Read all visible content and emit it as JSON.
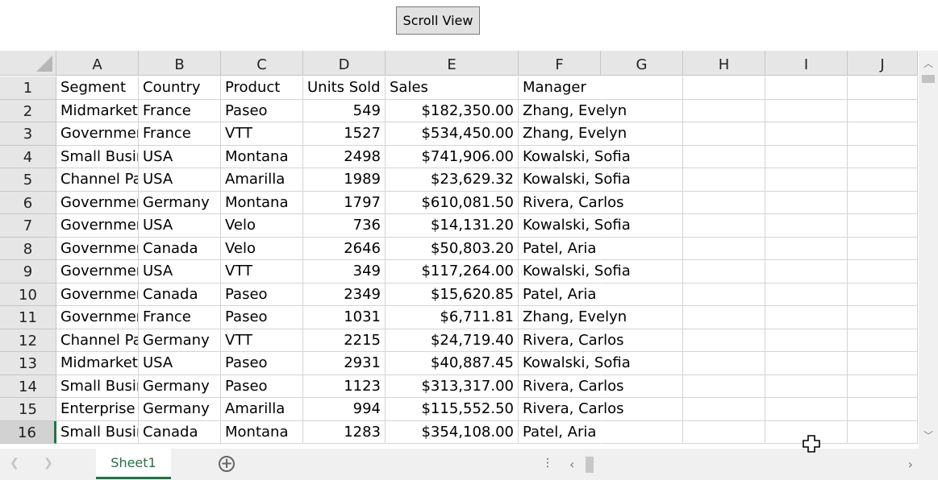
{
  "toolbar": {
    "scroll_view_label": "Scroll View"
  },
  "spreadsheet": {
    "columns": [
      "A",
      "B",
      "C",
      "D",
      "E",
      "F",
      "G",
      "H",
      "I",
      "J"
    ],
    "row_numbers": [
      "1",
      "2",
      "3",
      "4",
      "5",
      "6",
      "7",
      "8",
      "9",
      "10",
      "11",
      "12",
      "13",
      "14",
      "15",
      "16"
    ],
    "selected_row": "16",
    "headers": [
      "Segment",
      "Country",
      "Product",
      "Units Sold",
      "Sales",
      "Manager"
    ],
    "rows": [
      [
        "Midmarket",
        "France",
        "Paseo",
        "549",
        "$182,350.00",
        "Zhang, Evelyn"
      ],
      [
        "Government",
        "France",
        "VTT",
        "1527",
        "$534,450.00",
        "Zhang, Evelyn"
      ],
      [
        "Small Business",
        "USA",
        "Montana",
        "2498",
        "$741,906.00",
        "Kowalski, Sofia"
      ],
      [
        "Channel Partners",
        "USA",
        "Amarilla",
        "1989",
        "$23,629.32",
        "Kowalski, Sofia"
      ],
      [
        "Government",
        "Germany",
        "Montana",
        "1797",
        "$610,081.50",
        "Rivera, Carlos"
      ],
      [
        "Government",
        "USA",
        "Velo",
        "736",
        "$14,131.20",
        "Kowalski, Sofia"
      ],
      [
        "Government",
        "Canada",
        "Velo",
        "2646",
        "$50,803.20",
        "Patel, Aria"
      ],
      [
        "Government",
        "USA",
        "VTT",
        "349",
        "$117,264.00",
        "Kowalski, Sofia"
      ],
      [
        "Government",
        "Canada",
        "Paseo",
        "2349",
        "$15,620.85",
        "Patel, Aria"
      ],
      [
        "Government",
        "France",
        "Paseo",
        "1031",
        "$6,711.81",
        "Zhang, Evelyn"
      ],
      [
        "Channel Partners",
        "Germany",
        "VTT",
        "2215",
        "$24,719.40",
        "Rivera, Carlos"
      ],
      [
        "Midmarket",
        "USA",
        "Paseo",
        "2931",
        "$40,887.45",
        "Kowalski, Sofia"
      ],
      [
        "Small Business",
        "Germany",
        "Paseo",
        "1123",
        "$313,317.00",
        "Rivera, Carlos"
      ],
      [
        "Enterprise",
        "Germany",
        "Amarilla",
        "994",
        "$115,552.50",
        "Rivera, Carlos"
      ],
      [
        "Small Business",
        "Canada",
        "Montana",
        "1283",
        "$354,108.00",
        "Patel, Aria"
      ]
    ]
  },
  "sheet_tabs": {
    "active_tab": "Sheet1",
    "add_sheet_symbol": "+",
    "more_symbol": "⋮"
  },
  "colors": {
    "accent": "#217346",
    "header_bg": "#e6e6e6",
    "gridline": "#d4d4d4"
  }
}
